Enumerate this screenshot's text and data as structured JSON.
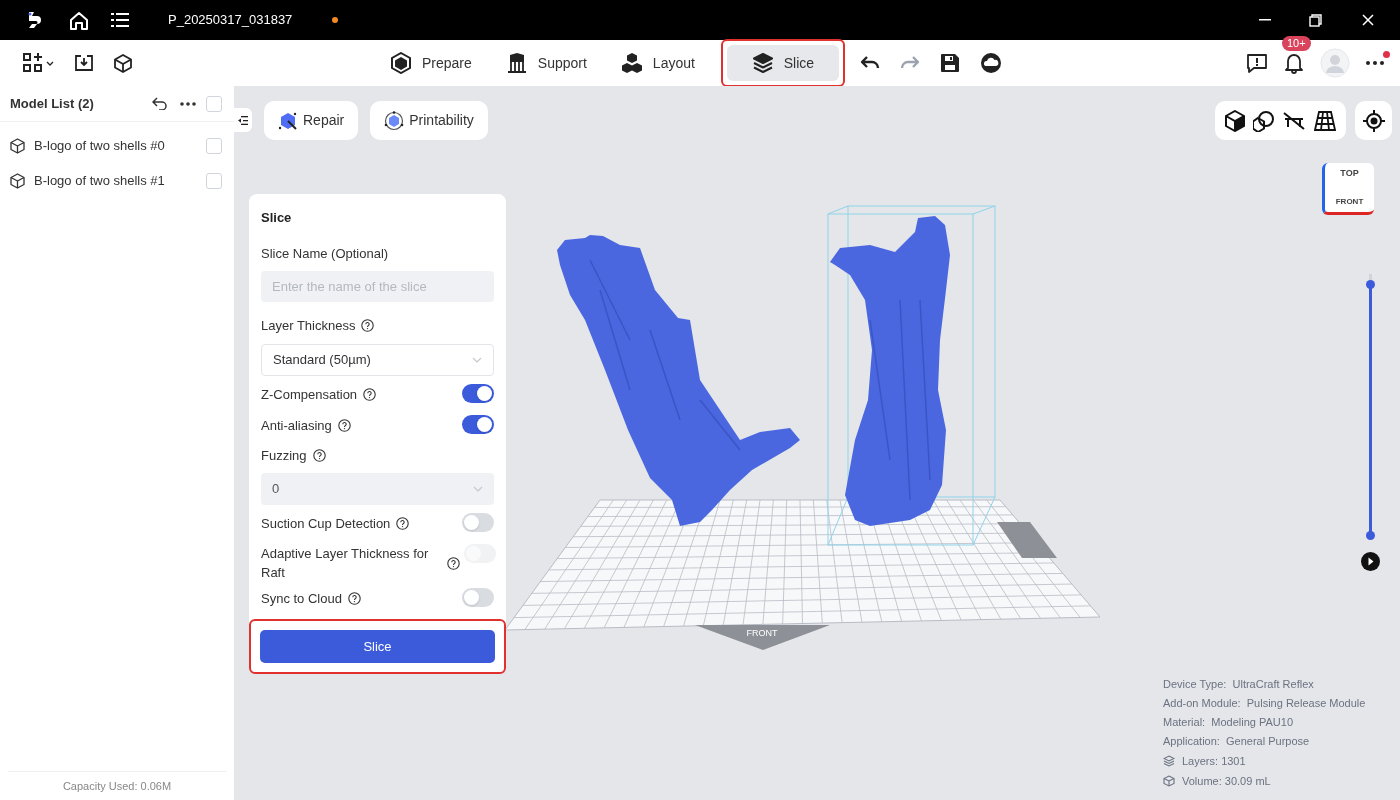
{
  "window": {
    "title": "P_20250317_031837",
    "unsaved": true
  },
  "toolbar": {
    "tabs": [
      {
        "label": "Prepare",
        "selected": false,
        "highlighted": false
      },
      {
        "label": "Support",
        "selected": false,
        "highlighted": false
      },
      {
        "label": "Layout",
        "selected": false,
        "highlighted": false
      },
      {
        "label": "Slice",
        "selected": true,
        "highlighted": true
      }
    ],
    "notification_badge": "10+",
    "more_unread": true
  },
  "model_list": {
    "title": "Model List (2)",
    "all_checked": false,
    "items": [
      {
        "name": "B-logo of two shells #0",
        "checked": false
      },
      {
        "name": "B-logo of two shells #1",
        "checked": false
      }
    ],
    "capacity": "Capacity Used: 0.06M"
  },
  "view_tools": [
    {
      "label": "Repair"
    },
    {
      "label": "Printability"
    }
  ],
  "slice_panel": {
    "title": "Slice",
    "name_label": "Slice Name (Optional)",
    "name_placeholder": "Enter the name of the slice",
    "fields": [
      {
        "kind": "select",
        "label": "Layer Thickness",
        "value": "Standard (50µm)",
        "disabled": false
      },
      {
        "kind": "toggle",
        "label": "Z-Compensation",
        "on": true,
        "disabled": false
      },
      {
        "kind": "toggle",
        "label": "Anti-aliasing",
        "on": true,
        "disabled": false
      },
      {
        "kind": "select",
        "label": "Fuzzing",
        "value": "0",
        "disabled": true
      },
      {
        "kind": "toggle",
        "label": "Suction Cup Detection",
        "on": false,
        "disabled": false
      },
      {
        "kind": "toggle",
        "label": "Adaptive Layer Thickness for Raft",
        "on": false,
        "disabled": true
      },
      {
        "kind": "toggle",
        "label": "Sync to Cloud",
        "on": false,
        "disabled": false
      }
    ],
    "button": {
      "label": "Slice",
      "highlighted": true
    }
  },
  "view_cube": {
    "top": "TOP",
    "front": "FRONT"
  },
  "plate_label": "FRONT",
  "layer_slider": {
    "level": 0.96
  },
  "print_info": {
    "lines": [
      "Device Type:  UltraCraft Reflex",
      "Add-on Module:  Pulsing Release Module",
      "Material:  Modeling PAU10",
      "Application:  General Purpose"
    ],
    "stats": [
      {
        "kind": "layers",
        "text": "Layers: 1301"
      },
      {
        "kind": "volume",
        "text": "Volume: 30.09 mL"
      }
    ]
  }
}
